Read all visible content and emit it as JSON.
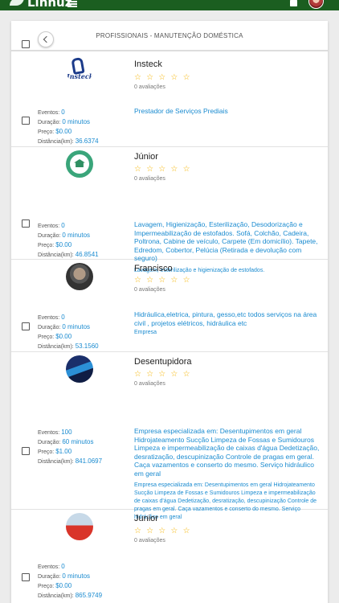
{
  "app": {
    "title": "Linnuz"
  },
  "panel": {
    "title": "PROFISSIONAIS - MANUTENÇÃO DOMÉSTICA"
  },
  "labels": {
    "eventos": "Eventos:",
    "duracao": "Duração:",
    "preco": "Preço:",
    "distancia": "Distância(km):"
  },
  "cards": [
    {
      "name": "Insteck",
      "stars": "☆ ☆ ☆ ☆ ☆",
      "reviews": "0 avaliações",
      "eventos": "0",
      "duracao": "0 minutos",
      "preco": "$0.00",
      "distancia": "36.6374",
      "description": "Prestador de Serviços Prediais",
      "sub": "",
      "logo_text": "Insteck"
    },
    {
      "name": "Júnior",
      "stars": "☆ ☆ ☆ ☆ ☆",
      "reviews": "0 avaliações",
      "eventos": "0",
      "duracao": "0 minutos",
      "preco": "$0.00",
      "distancia": "46.8541",
      "description": "Lavagem, Higienização, Esterilização, Desodorização e Impermeabilização de estofados. Sofá, Colchão, Cadeira, Poltrona, Cabine de veículo, Carpete (Em domicílio). Tapete, Edredom, Cobertor, Pelúcia (Retirada e devolução com seguro)",
      "sub": "Lavagem, esterilização e higienização de estofados."
    },
    {
      "name": "Francisco",
      "stars": "☆ ☆ ☆ ☆ ☆",
      "reviews": "0 avaliações",
      "eventos": "0",
      "duracao": "0 minutos",
      "preco": "$0.00",
      "distancia": "53.1560",
      "description": "Hidráulica,eletrica, pintura, gesso,etc todos serviços na área civil , projetos elétricos, hidráulica etc",
      "sub": "Empresa"
    },
    {
      "name": "Desentupidora",
      "stars": "☆ ☆ ☆ ☆ ☆",
      "reviews": "0 avaliações",
      "eventos": "100",
      "duracao": "60 minutos",
      "preco": "$1.00",
      "distancia": "841.0697",
      "description": "Empresa especializada em: Desentupimentos em geral Hidrojateamento Sucção Limpeza de Fossas e Sumidouros Limpeza e impermeabilização de caixas d'água Dedetização, desratização, descupinização Controle de pragas em geral. Caça vazamentos e conserto do mesmo. Serviço hidráulico em geral",
      "sub": "Empresa especializada em: Desentupimentos em geral Hidrojateamento Sucção Limpeza de Fossas e Sumidouros Limpeza e impermeabilização de caixas d'água Dedetização, desratização, descupinização Controle de pragas em geral. Caça vazamentos e conserto do mesmo. Serviço hidráulico em geral"
    },
    {
      "name": "Junior",
      "stars": "☆ ☆ ☆ ☆ ☆",
      "reviews": "0 avaliações",
      "eventos": "0",
      "duracao": "0 minutos",
      "preco": "$0.00",
      "distancia": "865.9749",
      "description": "",
      "sub": ""
    }
  ]
}
